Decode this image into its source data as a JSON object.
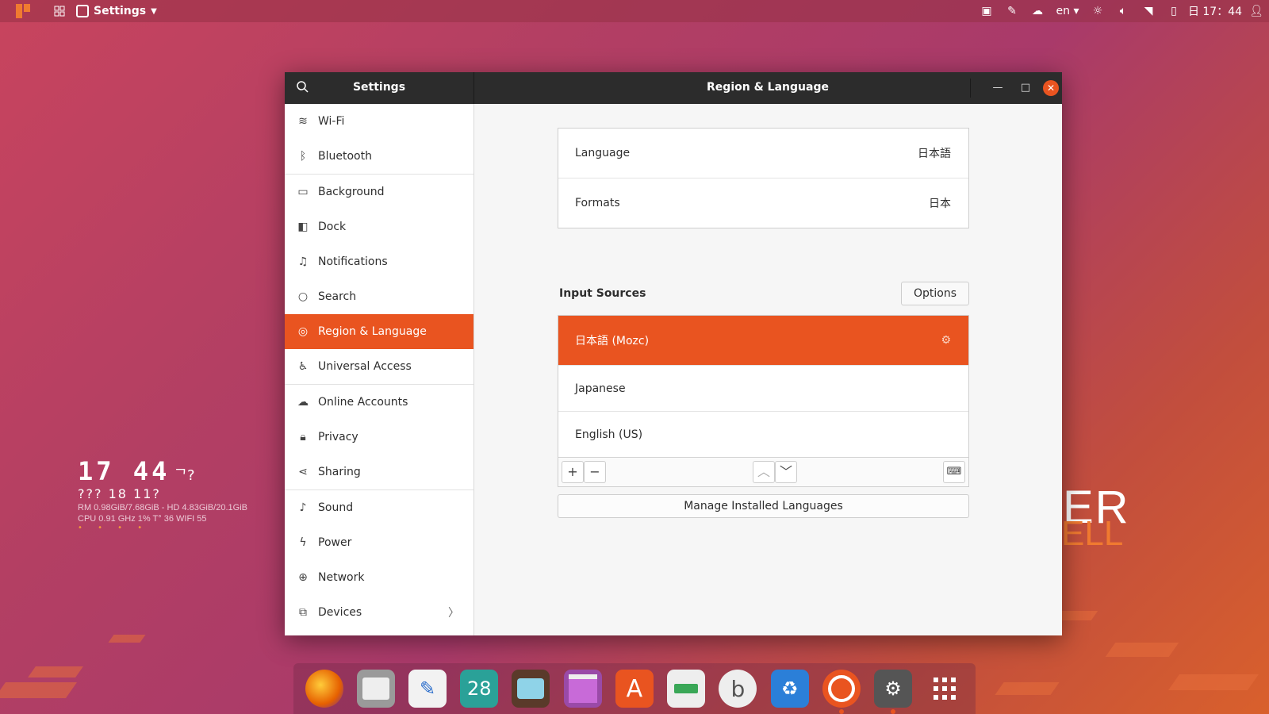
{
  "topbar": {
    "app_menu_label": "Settings",
    "keyboard_layout": "en",
    "clock": "日 17：44"
  },
  "widget": {
    "time": "17 44",
    "time_suffix": "ᄀ?",
    "date": "??? 18 11?",
    "line1": "RM 0.98GiB/7.68GiB - HD 4.83GiB/20.1GiB",
    "line2": "CPU 0.91  GHz 1% T° 36  WIFI 55",
    "dots": "• • • •"
  },
  "wallpaper_text": {
    "line1": "ER",
    "line2": "ELL"
  },
  "window": {
    "sidebar_title": "Settings",
    "page_title": "Region & Language"
  },
  "sidebar": {
    "items": [
      {
        "label": "Wi-Fi",
        "icon": "wifi-icon"
      },
      {
        "label": "Bluetooth",
        "icon": "bluetooth-icon"
      },
      {
        "label": "Background",
        "icon": "background-icon"
      },
      {
        "label": "Dock",
        "icon": "dock-icon"
      },
      {
        "label": "Notifications",
        "icon": "bell-icon"
      },
      {
        "label": "Search",
        "icon": "search-icon"
      },
      {
        "label": "Region & Language",
        "icon": "globe-icon",
        "active": true
      },
      {
        "label": "Universal Access",
        "icon": "accessibility-icon"
      },
      {
        "label": "Online Accounts",
        "icon": "cloud-icon"
      },
      {
        "label": "Privacy",
        "icon": "lock-icon"
      },
      {
        "label": "Sharing",
        "icon": "share-icon"
      },
      {
        "label": "Sound",
        "icon": "music-note-icon"
      },
      {
        "label": "Power",
        "icon": "power-icon"
      },
      {
        "label": "Network",
        "icon": "network-icon"
      },
      {
        "label": "Devices",
        "icon": "devices-icon"
      }
    ]
  },
  "region": {
    "language_label": "Language",
    "language_value": "日本語",
    "formats_label": "Formats",
    "formats_value": "日本"
  },
  "input_sources": {
    "heading": "Input Sources",
    "options_label": "Options",
    "sources": [
      {
        "label": "日本語 (Mozc)",
        "selected": true
      },
      {
        "label": "Japanese"
      },
      {
        "label": "English (US)"
      }
    ],
    "add_symbol": "+",
    "remove_symbol": "−",
    "up_symbol": "︿",
    "down_symbol": "﹀",
    "keyboard_symbol": "⌨"
  },
  "manage_languages_label": "Manage Installed Languages",
  "dock": {
    "apps": [
      "firefox-icon",
      "files-icon",
      "text-editor-icon",
      "calendar-icon",
      "tv-icon",
      "terminal-icon",
      "software-center-icon",
      "tweaks-icon",
      "b-app-icon",
      "trash-icon",
      "ubuntu-icon",
      "settings-gear-icon",
      "app-grid-icon"
    ],
    "calendar_day": "28"
  },
  "colors": {
    "accent": "#e95420",
    "headerbar": "#2c2c2c"
  }
}
